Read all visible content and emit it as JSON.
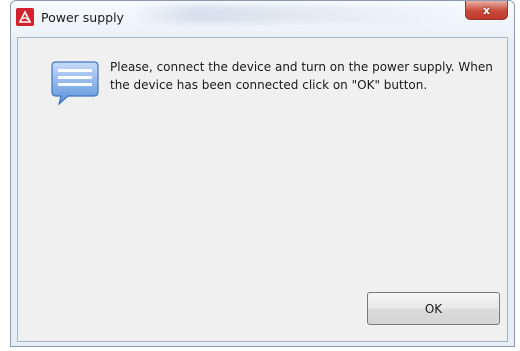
{
  "window": {
    "title": "Power supply",
    "close_glyph": "x",
    "app_icon": "app-logo-icon",
    "accent_colors": {
      "close_button": "#c94a3a",
      "app_icon": "#d2222b",
      "message_icon": "#4a86d8"
    }
  },
  "dialog": {
    "message_icon": "speech-bubble-icon",
    "message_line_1": "Please, connect the device and turn on the power supply. When",
    "message_line_2": "the device has been connected click on \"OK\" button.",
    "ok_label": "OK"
  }
}
